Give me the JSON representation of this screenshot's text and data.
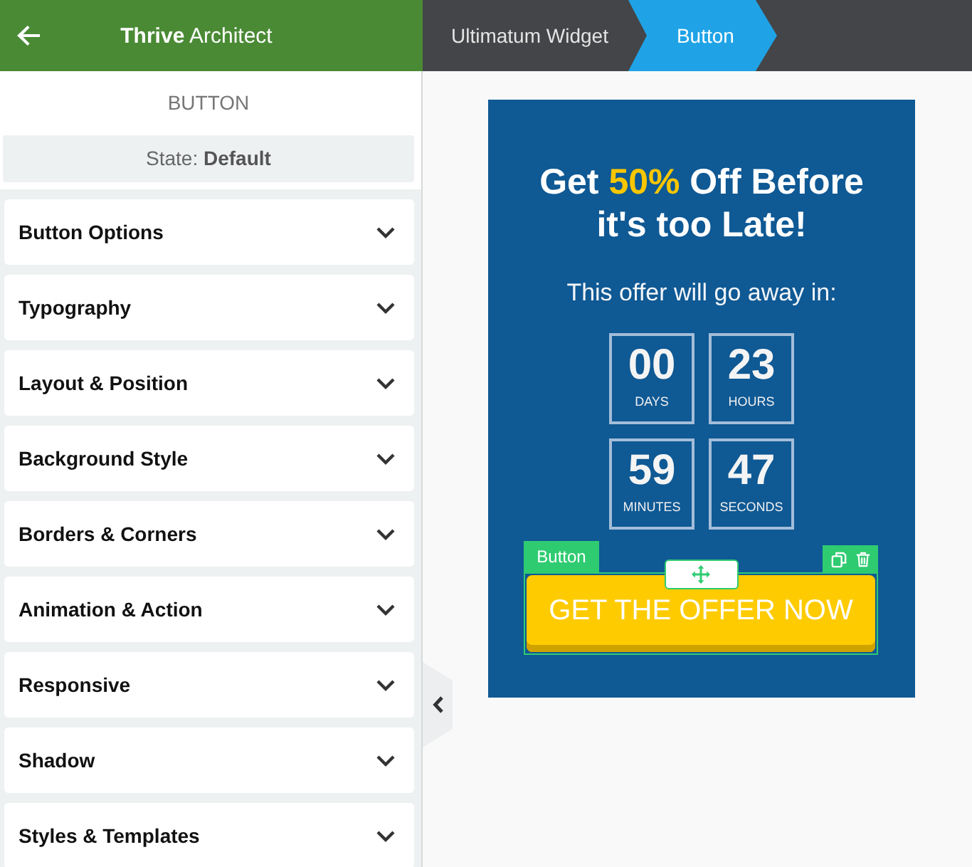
{
  "header": {
    "title": "**Thrive** Architect"
  },
  "breadcrumbs": [
    {
      "label": "Ultimatum Widget",
      "selected": false
    },
    {
      "label": "Button",
      "selected": true
    }
  ],
  "panel": {
    "title": "BUTTON",
    "state": "State: **Default**"
  },
  "sections": [
    {
      "label": "Button Options",
      "expanded": false
    },
    {
      "label": "Typography",
      "expanded": false
    },
    {
      "label": "Layout & Position",
      "expanded": false
    },
    {
      "label": "Background Style",
      "expanded": false
    },
    {
      "label": "Borders & Corners",
      "expanded": false
    },
    {
      "label": "Animation & Action",
      "expanded": false
    },
    {
      "label": "Responsive",
      "expanded": false
    },
    {
      "label": "Shadow",
      "expanded": false
    },
    {
      "label": "Styles & Templates",
      "expanded": false
    }
  ],
  "widget": {
    "headline": "Get **50%** Off Before it's too Late!",
    "subtitle": "This offer will go away in:",
    "countdown": [
      {
        "value": "00",
        "unit": "DAYS"
      },
      {
        "value": "23",
        "unit": "HOURS"
      },
      {
        "value": "59",
        "unit": "MINUTES"
      },
      {
        "value": "47",
        "unit": "SECONDS"
      }
    ],
    "button": {
      "label": "GET THE OFFER NOW",
      "selected": true,
      "tag": "Button"
    }
  }
}
